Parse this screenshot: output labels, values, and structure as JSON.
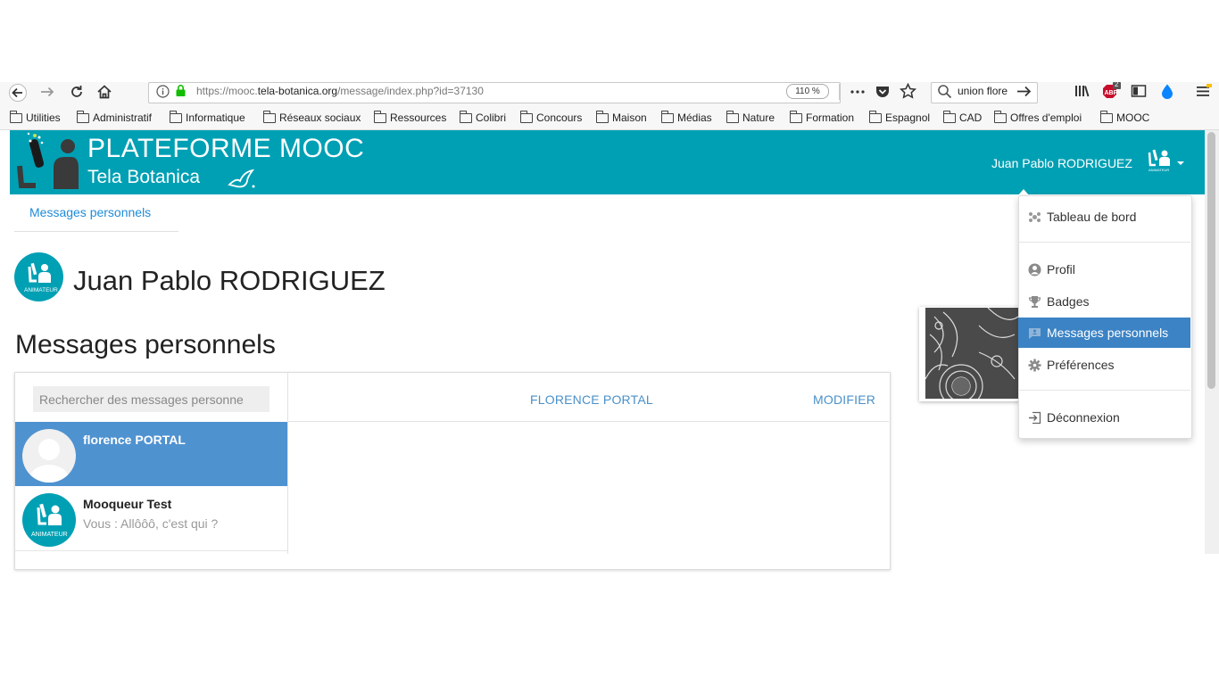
{
  "browser": {
    "url_prefix": "https://mooc.",
    "url_domain": "tela-botanica.org",
    "url_path": "/message/index.php?id=37130",
    "zoom": "110 %",
    "search_text": "union flore",
    "abp_badge": "2"
  },
  "bookmarks": [
    "Utilities",
    "Administratif",
    "Informatique",
    "Réseaux sociaux",
    "Ressources",
    "Colibri",
    "Concours",
    "Maison",
    "Médias",
    "Nature",
    "Formation",
    "Espagnol",
    "CAD",
    "Offres d'emploi",
    "MOOC"
  ],
  "header": {
    "title": "PLATEFORME MOOC",
    "subtitle": "Tela Botanica",
    "user_name": "Juan Pablo RODRIGUEZ"
  },
  "nav": {
    "tab": "Messages personnels"
  },
  "profile": {
    "name": "Juan Pablo RODRIGUEZ",
    "role_badge": "ANIMATEUR"
  },
  "section": {
    "title": "Messages personnels"
  },
  "messages": {
    "search_placeholder": "Rechercher des messages personne",
    "conversation_title": "FLORENCE PORTAL",
    "edit_label": "MODIFIER",
    "conversations": [
      {
        "name": "florence PORTAL",
        "snippet": "",
        "selected": true
      },
      {
        "name": "Mooqueur Test",
        "snippet": "Vous : Allôôô, c'est qui ?",
        "selected": false,
        "badge": "ANIMATEUR"
      }
    ]
  },
  "user_menu": {
    "items": [
      {
        "label": "Tableau de bord",
        "icon": "dashboard-icon"
      },
      {
        "label": "Profil",
        "icon": "user-icon"
      },
      {
        "label": "Badges",
        "icon": "trophy-icon"
      },
      {
        "label": "Messages personnels",
        "icon": "message-icon",
        "active": true
      },
      {
        "label": "Préférences",
        "icon": "gear-icon"
      },
      {
        "label": "Déconnexion",
        "icon": "logout-icon"
      }
    ]
  },
  "colors": {
    "header_bg": "#00a0b4",
    "link": "#1f8bd8",
    "selected_row": "#4f92d0",
    "menu_active": "#3b83c4"
  }
}
